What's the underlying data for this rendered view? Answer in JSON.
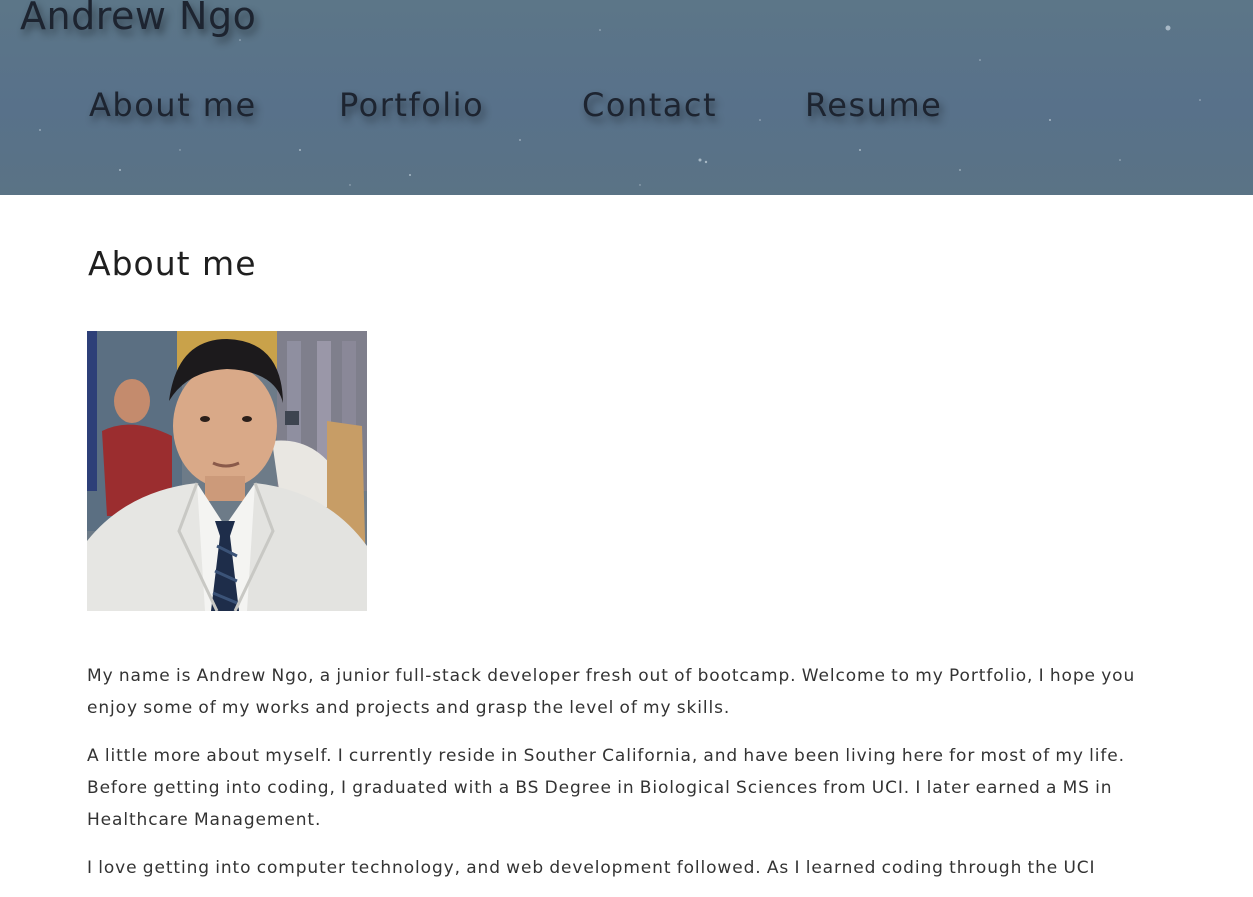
{
  "header": {
    "site_title": "Andrew Ngo",
    "nav": [
      {
        "label": "About me"
      },
      {
        "label": "Portfolio"
      },
      {
        "label": "Contact"
      },
      {
        "label": "Resume"
      }
    ],
    "background_color": "#5a7387"
  },
  "main": {
    "heading": "About me",
    "photo": {
      "icon": "profile-photo"
    },
    "paragraphs": [
      "My name is Andrew Ngo, a junior full-stack developer fresh out of bootcamp. Welcome to my Portfolio, I hope you enjoy some of my works and projects and grasp the level of my skills.",
      "A little more about myself. I currently reside in Souther California, and have been living here for most of my life. Before getting into coding, I graduated with a BS Degree in Biological Sciences from UCI. I later earned a MS in Healthcare Management.",
      "I love getting into computer technology, and web development followed. As I learned coding through the UCI"
    ]
  },
  "colors": {
    "text": "#333333",
    "heading": "#1f1f1f",
    "nav_text": "#1d2430"
  }
}
